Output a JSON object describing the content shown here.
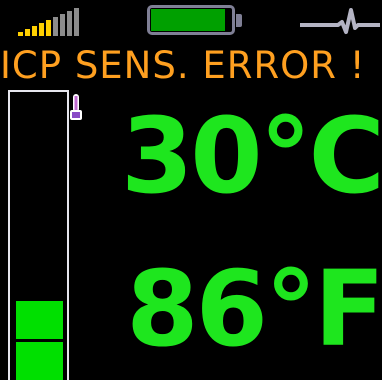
{
  "status": {
    "signal_icon": "signal-strength-icon",
    "signal_bars_lit": 5,
    "signal_bars_total": 9,
    "battery_icon": "battery-icon",
    "battery_level": 0.92,
    "pulse_icon": "pulse-waveform-icon"
  },
  "alert": {
    "text": "ICP SENS. ERROR !"
  },
  "gauge": {
    "icon": "thermometer-icon",
    "filled_segments": 2,
    "total_segments": 7
  },
  "temperature": {
    "celsius": "30°C",
    "fahrenheit": "86°F"
  },
  "colors": {
    "background": "#000000",
    "reading": "#1ee61e",
    "alert": "#ffa020",
    "gauge_fill": "#00e000",
    "signal_on": "#ffd000",
    "signal_off": "#8c8c8c",
    "battery_fill": "#00a000",
    "battery_frame": "#7f7f95"
  }
}
